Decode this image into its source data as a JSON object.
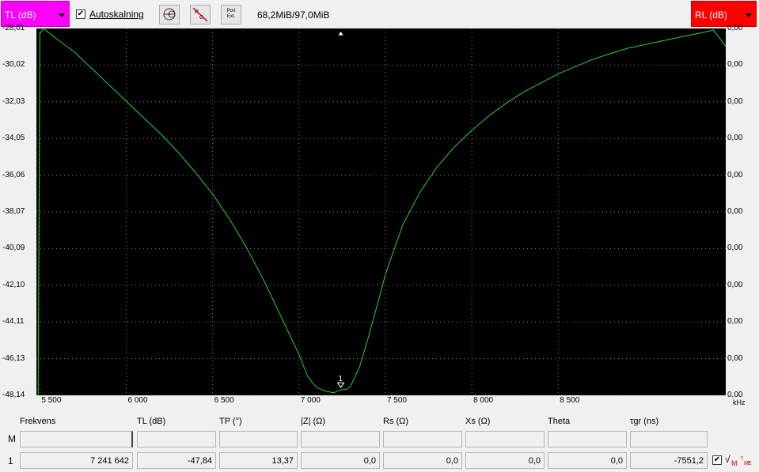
{
  "toolbar": {
    "left_selector": "TL (dB)",
    "autoscale_checked": "✔",
    "autoscale_label": "Autoskalning",
    "memory": "68,2MiB/97,0MiB",
    "right_selector": "RL (dB)",
    "port_btn_line1": "Port",
    "port_btn_line2": "Ext."
  },
  "plot": {
    "y_left_ticks": [
      "-28,01",
      "-30,02",
      "-32,03",
      "-34,05",
      "-36,06",
      "-38,07",
      "-40,09",
      "-42,10",
      "-44,11",
      "-46,13",
      "-48,14"
    ],
    "y_right_ticks": [
      "0,00",
      "0,00",
      "0,00",
      "0,00",
      "0,00",
      "0,00",
      "0,00",
      "0,00",
      "0,00",
      "0,00",
      "0,00"
    ],
    "x_ticks": [
      "5 500",
      "6 000",
      "6 500",
      "7 000",
      "7 500",
      "8 000",
      "8 500"
    ],
    "x_unit": "kHz",
    "marker_label": "1",
    "trace_color": "#33cc33",
    "background": "#000000"
  },
  "chart_data": {
    "type": "line",
    "x_range": [
      5480,
      9470
    ],
    "ylim": [
      -48.14,
      -28.01
    ],
    "series": [
      {
        "x": [
          5490,
          5500,
          5520,
          5600,
          5700,
          5800,
          5900,
          6000,
          6100,
          6200,
          6300,
          6400,
          6500,
          6600,
          6700,
          6800,
          6900,
          7000,
          7050,
          7100,
          7150,
          7200,
          7241,
          7280,
          7300,
          7350,
          7400,
          7450,
          7500,
          7600,
          7700,
          7800,
          7900,
          8000,
          8100,
          8200,
          8300,
          8400,
          8500,
          8600,
          8700,
          8800,
          8900,
          9000,
          9100,
          9200,
          9300,
          9400,
          9470
        ],
        "y": [
          -48.14,
          -28.3,
          -28.0,
          -28.6,
          -29.3,
          -30.2,
          -31.1,
          -32.0,
          -32.9,
          -33.8,
          -34.8,
          -35.9,
          -37.1,
          -38.5,
          -40.1,
          -41.9,
          -43.9,
          -45.9,
          -47.1,
          -47.7,
          -47.9,
          -48.0,
          -47.84,
          -47.8,
          -47.6,
          -46.6,
          -45.0,
          -43.3,
          -41.5,
          -38.8,
          -37.0,
          -35.6,
          -34.5,
          -33.6,
          -32.8,
          -32.1,
          -31.5,
          -31.0,
          -30.5,
          -30.1,
          -29.7,
          -29.4,
          -29.1,
          -28.9,
          -28.7,
          -28.5,
          -28.3,
          -28.1,
          -29.0
        ]
      }
    ]
  },
  "table": {
    "headers": [
      "Frekvens",
      "TL (dB)",
      "TP (°)",
      "|Z| (Ω)",
      "Rs (Ω)",
      "Xs (Ω)",
      "Theta",
      "τgr (ns)"
    ],
    "row_m_label": "M",
    "row_1_label": "1",
    "row_1_values": [
      "7 241 642",
      "-47,84",
      "13,37",
      "0,0",
      "0,0",
      "0,0",
      "0,0",
      "-7551,2"
    ],
    "row_1_checked": "✔"
  }
}
